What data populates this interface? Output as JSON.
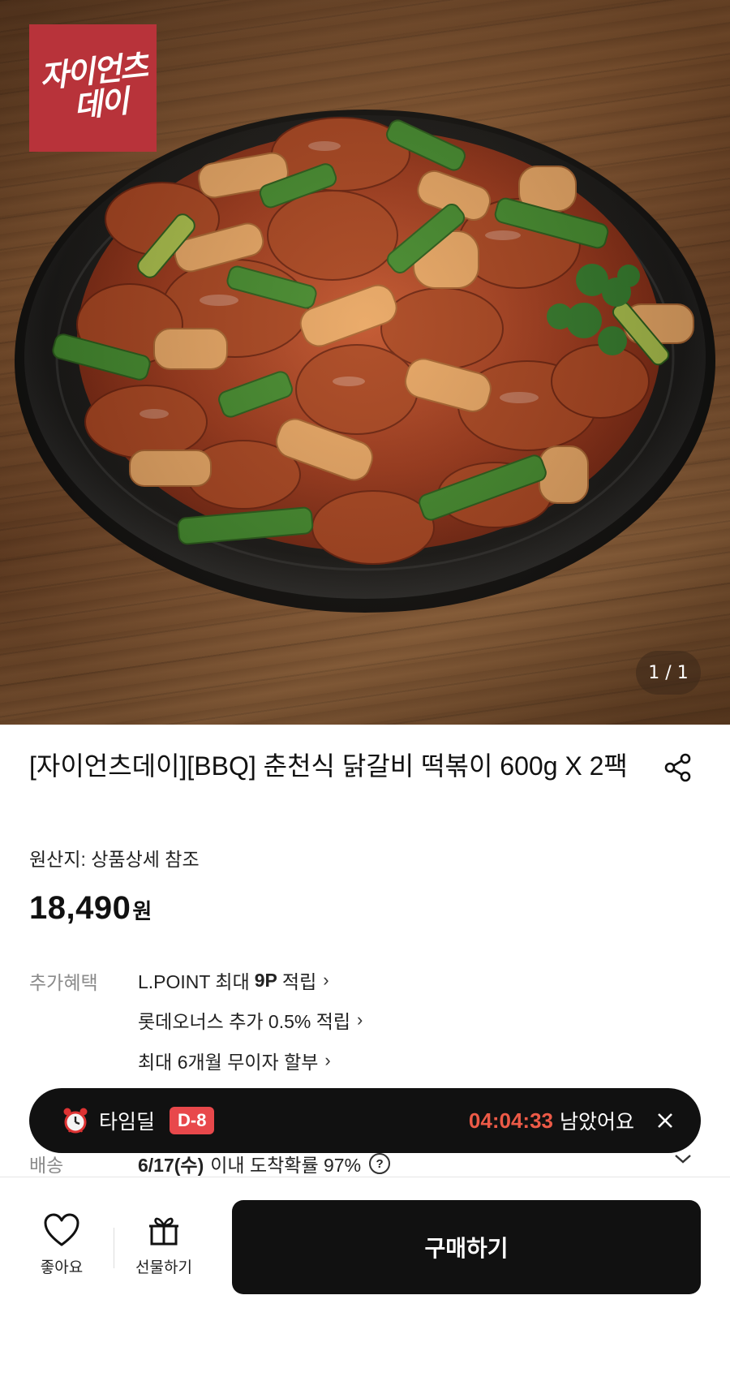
{
  "hero": {
    "brand_logo": {
      "line1": "자이언츠",
      "line2": "데이",
      "color": "#b8333a"
    },
    "image_counter": "1 / 1"
  },
  "product": {
    "title": "[자이언츠데이][BBQ] 춘천식 닭갈비 떡볶이 600g X 2팩",
    "origin": "원산지: 상품상세 참조",
    "price": "18,490",
    "price_unit": "원"
  },
  "benefits": {
    "label": "추가혜택",
    "items": [
      {
        "prefix": "L.POINT 최대",
        "highlight": "9P",
        "suffix": "적립"
      },
      {
        "text": "롯데오너스 추가 0.5% 적립"
      },
      {
        "text": "최대 6개월 무이자 할부"
      }
    ]
  },
  "shipping": {
    "label": "배송",
    "date": "6/17(수)",
    "text": "이내 도착확률 97%",
    "help": "?"
  },
  "timedeal": {
    "label": "타임딜",
    "badge": "D-8",
    "countdown": "04:04:33",
    "remain_text": "남았어요",
    "badge_color": "#e8484b",
    "countdown_color": "#ec5a47"
  },
  "bottom_bar": {
    "like_label": "좋아요",
    "gift_label": "선물하기",
    "buy_label": "구매하기"
  }
}
